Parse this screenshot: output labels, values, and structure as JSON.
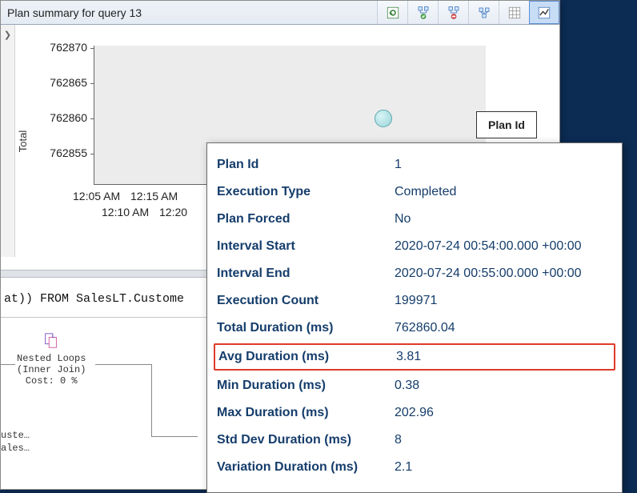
{
  "title": "Plan summary for query 13",
  "toolbar": {
    "buttons": [
      {
        "name": "refresh-icon"
      },
      {
        "name": "trace-toggle-icon"
      },
      {
        "name": "metric-select-icon"
      },
      {
        "name": "group-icon"
      },
      {
        "name": "grid-view-icon"
      },
      {
        "name": "chart-view-icon"
      }
    ],
    "activeIndex": 5
  },
  "chart": {
    "ylabel": "Total",
    "legend": "Plan Id"
  },
  "chart_data": {
    "type": "scatter",
    "title": "",
    "xlabel": "",
    "ylabel": "Total",
    "yticks": [
      762855,
      762860,
      762865,
      762870
    ],
    "ylim": [
      762852,
      762872
    ],
    "xticks_row1": [
      "12:05 AM",
      "12:15 AM"
    ],
    "xticks_row2": [
      "12:10 AM",
      "12:20"
    ],
    "series": [
      {
        "name": "Plan 1",
        "points": [
          {
            "x_label": "",
            "y": 762860
          }
        ]
      }
    ]
  },
  "sql": {
    "fragment": "at)) FROM SalesLT.Custome"
  },
  "plan": {
    "node": {
      "op": "Nested Loops",
      "join": "(Inner Join)",
      "cost": "Cost: 0 %"
    },
    "leaf1": "uste…",
    "leaf2": "ales…"
  },
  "tooltip": {
    "rows": [
      {
        "label": "Plan Id",
        "value": "1"
      },
      {
        "label": "Execution Type",
        "value": "Completed"
      },
      {
        "label": "Plan Forced",
        "value": "No"
      },
      {
        "label": "Interval Start",
        "value": "2020-07-24 00:54:00.000 +00:00"
      },
      {
        "label": "Interval End",
        "value": "2020-07-24 00:55:00.000 +00:00"
      },
      {
        "label": "Execution Count",
        "value": "199971"
      },
      {
        "label": "Total Duration (ms)",
        "value": "762860.04"
      },
      {
        "label": "Avg Duration (ms)",
        "value": "3.81",
        "highlight": true
      },
      {
        "label": "Min Duration (ms)",
        "value": "0.38"
      },
      {
        "label": "Max Duration (ms)",
        "value": "202.96"
      },
      {
        "label": "Std Dev Duration (ms)",
        "value": "8"
      },
      {
        "label": "Variation Duration (ms)",
        "value": "2.1"
      }
    ]
  }
}
